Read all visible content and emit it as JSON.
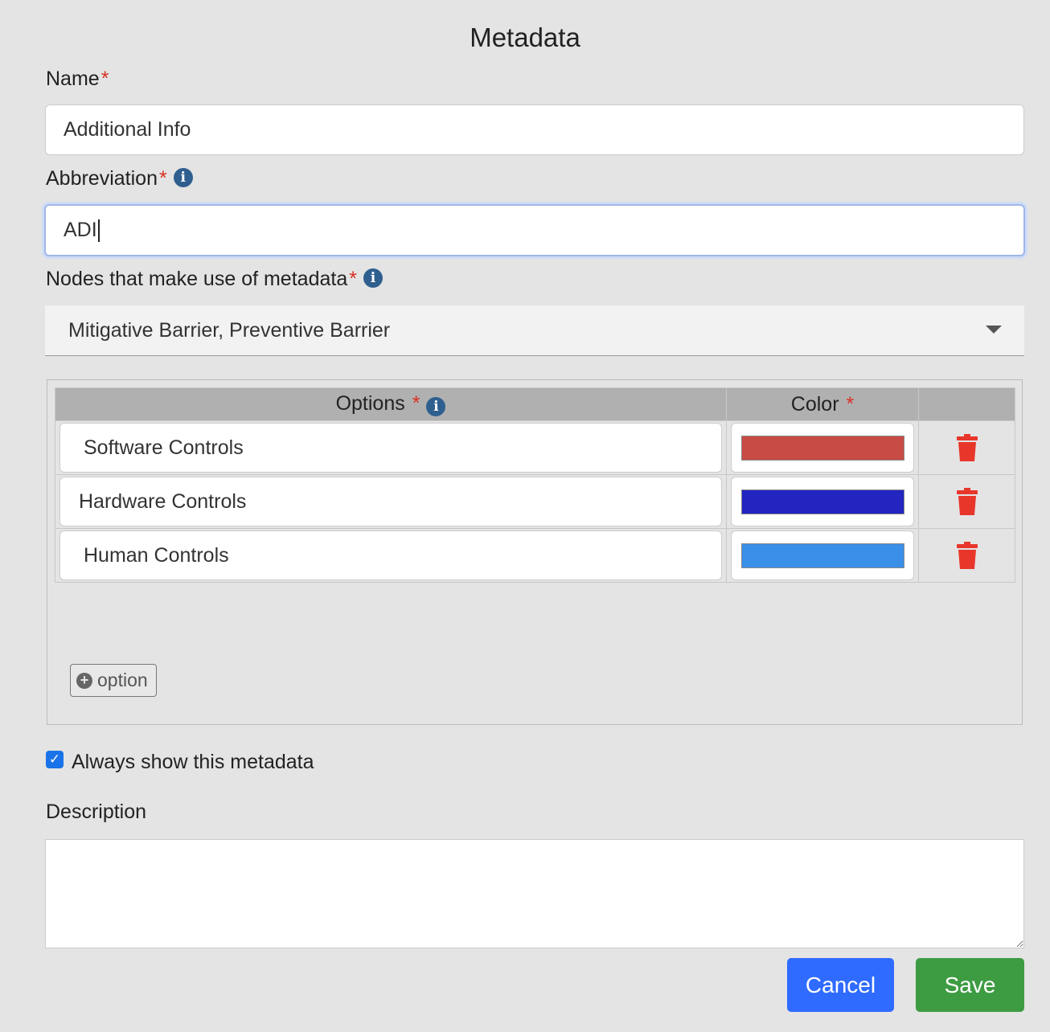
{
  "dialog": {
    "title": "Metadata"
  },
  "name": {
    "label": "Name",
    "required_mark": "*",
    "value": "Additional Info"
  },
  "abbreviation": {
    "label": "Abbreviation",
    "required_mark": "*",
    "value": "ADI"
  },
  "nodes": {
    "label": "Nodes that make use of metadata",
    "required_mark": "*",
    "selected": "Mitigative Barrier, Preventive Barrier"
  },
  "options_table": {
    "headers": {
      "options": "Options",
      "color": "Color",
      "required_mark": "*"
    },
    "rows": [
      {
        "label": "Software Controls",
        "color": "#c84b46"
      },
      {
        "label": "Hardware Controls",
        "color": "#2225c0"
      },
      {
        "label": "Human Controls",
        "color": "#3a8fe8"
      }
    ],
    "add_label": "option",
    "delete_color": "#e8362a"
  },
  "always_show": {
    "label": "Always show this metadata",
    "checked": true
  },
  "description": {
    "label": "Description",
    "value": ""
  },
  "buttons": {
    "cancel": "Cancel",
    "save": "Save"
  },
  "colors": {
    "info_icon": "#2f5f8f",
    "required": "#d93025",
    "cancel_bg": "#2f6bff",
    "save_bg": "#3d9b42",
    "checkbox": "#1a73e8"
  }
}
